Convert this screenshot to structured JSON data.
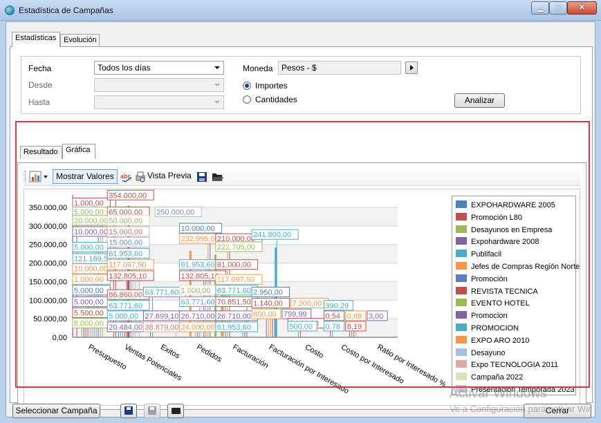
{
  "window": {
    "title": "Estadística de Campañas"
  },
  "tabs": [
    {
      "label": "Estadísticas"
    },
    {
      "label": "Evolución"
    }
  ],
  "filters": {
    "fecha_label": "Fecha",
    "fecha_value": "Todos los días",
    "desde_label": "Desde",
    "hasta_label": "Hasta",
    "moneda_label": "Moneda",
    "moneda_value": "Pesos - $",
    "importes_label": "Importes",
    "cantidades_label": "Cantidades",
    "analizar_label": "Analizar"
  },
  "result_tabs": [
    {
      "label": "Resultado"
    },
    {
      "label": "Gráfica"
    }
  ],
  "toolbar": {
    "mostrar_valores": "Mostrar Valores",
    "vista_previa": "Vista Previa"
  },
  "chart_data": {
    "type": "bar",
    "categories": [
      "Presupuesto",
      "Ventas Potenciales",
      "Exitos",
      "Pedidos",
      "Facturación",
      "Facturación por Interesado",
      "Costo",
      "Costo por Interesado",
      "Ratio por Interesado %"
    ],
    "yticks": [
      "350.000,00",
      "300.000,00",
      "250.000,00",
      "200.000,00",
      "150.000,00",
      "100.000,00",
      "50.000,00",
      "0,00"
    ],
    "ylim": [
      0,
      350000
    ],
    "grid": true,
    "legend_position": "right",
    "series": [
      {
        "name": "EXPOHARDWARE 2005",
        "color": "#4f81bd"
      },
      {
        "name": "Promoción L80",
        "color": "#c0504d"
      },
      {
        "name": "Desayunos en Empresa",
        "color": "#9bbb59"
      },
      {
        "name": "Expohardware 2008",
        "color": "#8064a2"
      },
      {
        "name": "Publifacil",
        "color": "#4bacc6"
      },
      {
        "name": "Jefes de Compras Región Norte",
        "color": "#f79646"
      },
      {
        "name": "Promoción",
        "color": "#5b7fc2"
      },
      {
        "name": "REVISTA TECNICA",
        "color": "#c0504d"
      },
      {
        "name": "EVENTO HOTEL",
        "color": "#9bbb59"
      },
      {
        "name": "Promocion",
        "color": "#8064a2"
      },
      {
        "name": "PROMOCION",
        "color": "#4bacc6"
      },
      {
        "name": "EXPO ARO 2010",
        "color": "#f79646"
      },
      {
        "name": "Desayuno",
        "color": "#a7c0e2"
      },
      {
        "name": "Expo TECNOLOGIA 2011",
        "color": "#e0a9a7"
      },
      {
        "name": "Campaña 2022",
        "color": "#d6e4b9"
      },
      {
        "name": "Presentación Temporada 2023",
        "color": "#cfc3e0"
      }
    ],
    "data_labels": [
      {
        "text": "1.000,00",
        "color": "#c0504d",
        "category": 0,
        "y": 362000
      },
      {
        "text": "5.000,00",
        "color": "#9bbb59",
        "category": 0,
        "y": 338000
      },
      {
        "text": "20.000,00",
        "color": "#9bbb59",
        "category": 0,
        "y": 315000
      },
      {
        "text": "10.000,00",
        "color": "#8064a2",
        "category": 0,
        "y": 285000
      },
      {
        "text": "5.000,00",
        "color": "#4bacc6",
        "category": 0,
        "y": 243000
      },
      {
        "text": "121.169,52",
        "color": "#4bacc6",
        "category": 0,
        "y": 212000
      },
      {
        "text": "10.000,00",
        "color": "#f79646",
        "category": 0,
        "y": 185000
      },
      {
        "text": "1.000,00",
        "color": "#f79646",
        "category": 0,
        "y": 156000
      },
      {
        "text": "5.000,00",
        "color": "#4f81bd",
        "category": 0,
        "y": 127000
      },
      {
        "text": "5.000,00",
        "color": "#8064a2",
        "category": 0,
        "y": 96000
      },
      {
        "text": "5.500,00",
        "color": "#c0504d",
        "category": 0,
        "y": 66000
      },
      {
        "text": "8.000,00",
        "color": "#9bbb59",
        "category": 0,
        "y": 38000
      },
      {
        "text": "354.000,00",
        "color": "#c0504d",
        "category": 1,
        "y": 383000
      },
      {
        "text": "65.000,00",
        "color": "#c0504d",
        "category": 1,
        "y": 338000
      },
      {
        "text": "250.000,00",
        "color": "#a7c0e2",
        "category": 1,
        "y": 338000
      },
      {
        "text": "50.000,00",
        "color": "#d6e4b9",
        "category": 1,
        "y": 315000
      },
      {
        "text": "15.000,00",
        "color": "#e0a9a7",
        "category": 1,
        "y": 285000
      },
      {
        "text": "15.000,00",
        "color": "#a7c0e2",
        "category": 1,
        "y": 256000
      },
      {
        "text": "61.953,60",
        "color": "#4bacc6",
        "category": 1,
        "y": 226000
      },
      {
        "text": "117.097,50",
        "color": "#f79646",
        "category": 1,
        "y": 196000
      },
      {
        "text": "132.805,10",
        "color": "#c0504d",
        "category": 1,
        "y": 166000
      },
      {
        "text": "86.860,00",
        "color": "#c0504d",
        "category": 1,
        "y": 115000
      },
      {
        "text": "63.771,60",
        "color": "#4bacc6",
        "category": 1,
        "y": 86000
      },
      {
        "text": "5.000,00",
        "color": "#4bacc6",
        "category": 1,
        "y": 58000
      },
      {
        "text": "20.484,00",
        "color": "#8064a2",
        "category": 1,
        "y": 28000
      },
      {
        "text": "63.771,60",
        "color": "#4bacc6",
        "category": 2,
        "y": 122000
      },
      {
        "text": "27.699,10",
        "color": "#8064a2",
        "category": 2,
        "y": 58000
      },
      {
        "text": "38.879,00",
        "color": "#e0a9a7",
        "category": 2,
        "y": 28000
      },
      {
        "text": "10.000,00",
        "color": "#4f81bd",
        "category": 3,
        "y": 294000
      },
      {
        "text": "232.995,00",
        "color": "#f79646",
        "category": 3,
        "y": 266000
      },
      {
        "text": "61.953,60",
        "color": "#4bacc6",
        "category": 3,
        "y": 196000
      },
      {
        "text": "132.805,10",
        "color": "#c0504d",
        "category": 3,
        "y": 166000
      },
      {
        "text": "1.000,00",
        "color": "#d6e4b9",
        "category": 3,
        "y": 127000
      },
      {
        "text": "63.771,60",
        "color": "#4bacc6",
        "category": 3,
        "y": 96000
      },
      {
        "text": "26.710,00",
        "color": "#8064a2",
        "category": 3,
        "y": 58000
      },
      {
        "text": "24.000,00",
        "color": "#f79646",
        "category": 3,
        "y": 28000
      },
      {
        "text": "210.000,00",
        "color": "#c0504d",
        "category": 4,
        "y": 266000
      },
      {
        "text": "222.705,00",
        "color": "#9bbb59",
        "category": 4,
        "y": 244000
      },
      {
        "text": "81.000,00",
        "color": "#c0504d",
        "category": 4,
        "y": 196000
      },
      {
        "text": "117.097,50",
        "color": "#f79646",
        "category": 4,
        "y": 156000
      },
      {
        "text": "63.771,60",
        "color": "#4bacc6",
        "category": 4,
        "y": 127000
      },
      {
        "text": "70.851,50",
        "color": "#c0504d",
        "category": 4,
        "y": 96000
      },
      {
        "text": "26.710,00",
        "color": "#8064a2",
        "category": 4,
        "y": 58000
      },
      {
        "text": "61.953,60",
        "color": "#4bacc6",
        "category": 4,
        "y": 28000
      },
      {
        "text": "241.800,00",
        "color": "#4bacc6",
        "category": 5,
        "y": 277000
      },
      {
        "text": "2.950,00",
        "color": "#4f81bd",
        "category": 5,
        "y": 122000
      },
      {
        "text": "1.140,00",
        "color": "#c0504d",
        "category": 5,
        "y": 92000
      },
      {
        "text": "7.200,00",
        "color": "#f79646",
        "category": 5,
        "y": 92000
      },
      {
        "text": "800,00",
        "color": "#f79646",
        "category": 5,
        "y": 63000
      },
      {
        "text": "799,99",
        "color": "#8064a2",
        "category": 5,
        "y": 63000
      },
      {
        "text": "5.800,00",
        "color": "#c0504d",
        "category": 6,
        "y": 38000
      },
      {
        "text": "500,00",
        "color": "#4bacc6",
        "category": 6,
        "y": 30000
      },
      {
        "text": "390,29",
        "color": "#4bacc6",
        "category": 7,
        "y": 86000
      },
      {
        "text": "0,54",
        "color": "#c0504d",
        "category": 7,
        "y": 58000
      },
      {
        "text": "0,68",
        "color": "#f79646",
        "category": 7,
        "y": 58000
      },
      {
        "text": "3,00",
        "color": "#8064a2",
        "category": 7,
        "y": 58000
      },
      {
        "text": "0,78",
        "color": "#4bacc6",
        "category": 7,
        "y": 30000
      },
      {
        "text": "8,19",
        "color": "#c0504d",
        "category": 7,
        "y": 30000
      }
    ]
  },
  "bottom": {
    "seleccionar_label": "Seleccionar Campaña",
    "cerrar_label": "Cerrar"
  },
  "watermark": {
    "line1": "Activar Windows",
    "line2": "Ve a Configuración para activar Windows."
  }
}
